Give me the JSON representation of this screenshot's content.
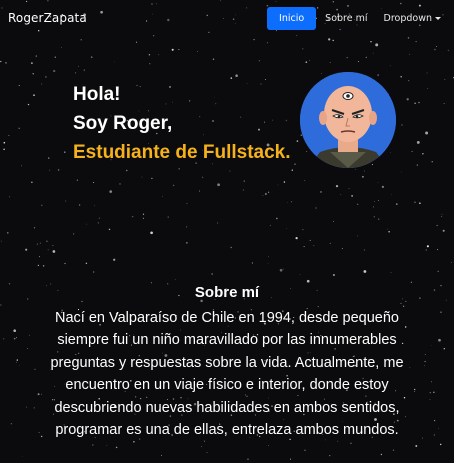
{
  "navbar": {
    "brand": "RogerZapata",
    "links": [
      {
        "label": "Inicio",
        "active": true
      },
      {
        "label": "Sobre mí",
        "active": false
      },
      {
        "label": "Dropdown",
        "active": false,
        "has_caret": true
      }
    ]
  },
  "hero": {
    "line1": "Hola!",
    "line2": "Soy Roger,",
    "line3": "Estudiante de Fullstack."
  },
  "avatar": {
    "description_icon": "profile-avatar",
    "bg_color": "#2f6cdb"
  },
  "about": {
    "title": "Sobre mí",
    "text": "Nací en Valparaíso de Chile en 1994, desde pequeño siempre fui un niño maravillado por las innumerables preguntas y respuestas sobre la vida. Actualmente, me encuentro en un viaje físico e interior, donde estoy descubriendo nuevas habilidades en ambos sentidos, programar es una de ellas, entrelaza ambos mundos."
  },
  "colors": {
    "accent": "#f6b21b",
    "primary": "#0d6efd",
    "background": "#0b0b0d"
  }
}
